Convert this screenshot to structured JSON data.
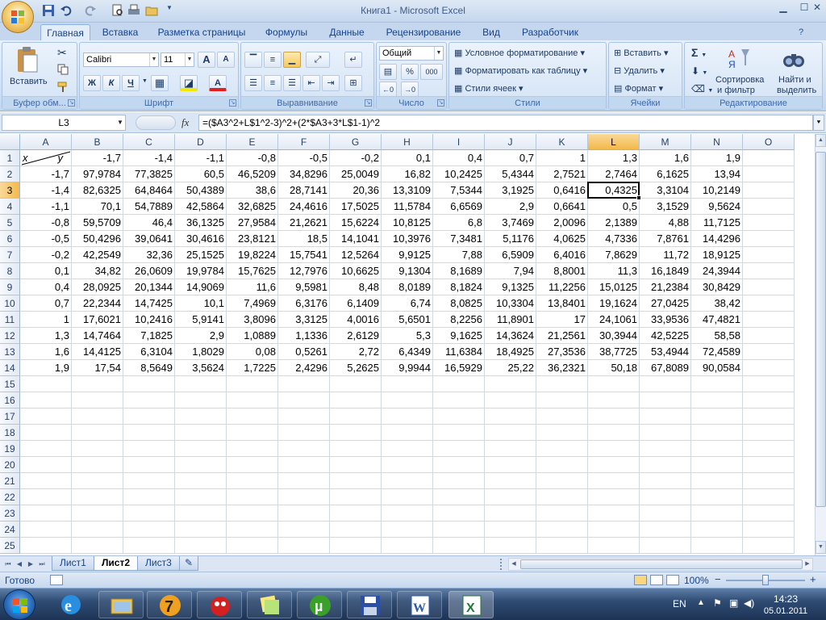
{
  "window": {
    "title": "Книга1 - Microsoft Excel"
  },
  "tabs": [
    "Главная",
    "Вставка",
    "Разметка страницы",
    "Формулы",
    "Данные",
    "Рецензирование",
    "Вид",
    "Разработчик"
  ],
  "ribbon": {
    "clipboard": {
      "label": "Буфер обм...",
      "paste": "Вставить"
    },
    "font": {
      "label": "Шрифт",
      "font_name": "Calibri",
      "font_size": "11",
      "bold": "Ж",
      "italic": "К",
      "underline": "Ч",
      "grow": "A",
      "shrink": "A",
      "font_color_glyph": "A"
    },
    "alignment": {
      "label": "Выравнивание"
    },
    "number": {
      "label": "Число",
      "format": "Общий",
      "percent": "%",
      "thousands": "000"
    },
    "styles": {
      "label": "Стили",
      "conditional": "Условное форматирование",
      "as_table": "Форматировать как таблицу",
      "cell_styles": "Стили ячеек"
    },
    "cells": {
      "label": "Ячейки",
      "insert": "Вставить",
      "delete": "Удалить",
      "format": "Формат"
    },
    "editing": {
      "label": "Редактирование",
      "sigma": "Σ",
      "sort": "Сортировка",
      "sort2": "и фильтр",
      "find": "Найти и",
      "find2": "выделить"
    }
  },
  "formula_bar": {
    "name_box": "L3",
    "fx": "fx",
    "formula": "=($A3^2+L$1^2-3)^2+(2*$A3+3*L$1-1)^2"
  },
  "grid": {
    "columns": [
      "A",
      "B",
      "C",
      "D",
      "E",
      "F",
      "G",
      "H",
      "I",
      "J",
      "K",
      "L",
      "M",
      "N",
      "O"
    ],
    "selected_column": "L",
    "selected_row": 3,
    "active_cell": "L3",
    "row_count": 25,
    "a1_x": "x",
    "a1_y": "y",
    "header_row": [
      "-1,7",
      "-1,4",
      "-1,1",
      "-0,8",
      "-0,5",
      "-0,2",
      "0,1",
      "0,4",
      "0,7",
      "1",
      "1,3",
      "1,6",
      "1,9"
    ],
    "rows": [
      [
        "-1,7",
        "97,9784",
        "77,3825",
        "60,5",
        "46,5209",
        "34,8296",
        "25,0049",
        "16,82",
        "10,2425",
        "5,4344",
        "2,7521",
        "2,7464",
        "6,1625",
        "13,94"
      ],
      [
        "-1,4",
        "82,6325",
        "64,8464",
        "50,4389",
        "38,6",
        "28,7141",
        "20,36",
        "13,3109",
        "7,5344",
        "3,1925",
        "0,6416",
        "0,4325",
        "3,3104",
        "10,2149"
      ],
      [
        "-1,1",
        "70,1",
        "54,7889",
        "42,5864",
        "32,6825",
        "24,4616",
        "17,5025",
        "11,5784",
        "6,6569",
        "2,9",
        "0,6641",
        "0,5",
        "3,1529",
        "9,5624"
      ],
      [
        "-0,8",
        "59,5709",
        "46,4",
        "36,1325",
        "27,9584",
        "21,2621",
        "15,6224",
        "10,8125",
        "6,8",
        "3,7469",
        "2,0096",
        "2,1389",
        "4,88",
        "11,7125"
      ],
      [
        "-0,5",
        "50,4296",
        "39,0641",
        "30,4616",
        "23,8121",
        "18,5",
        "14,1041",
        "10,3976",
        "7,3481",
        "5,1176",
        "4,0625",
        "4,7336",
        "7,8761",
        "14,4296"
      ],
      [
        "-0,2",
        "42,2549",
        "32,36",
        "25,1525",
        "19,8224",
        "15,7541",
        "12,5264",
        "9,9125",
        "7,88",
        "6,5909",
        "6,4016",
        "7,8629",
        "11,72",
        "18,9125"
      ],
      [
        "0,1",
        "34,82",
        "26,0609",
        "19,9784",
        "15,7625",
        "12,7976",
        "10,6625",
        "9,1304",
        "8,1689",
        "7,94",
        "8,8001",
        "11,3",
        "16,1849",
        "24,3944"
      ],
      [
        "0,4",
        "28,0925",
        "20,1344",
        "14,9069",
        "11,6",
        "9,5981",
        "8,48",
        "8,0189",
        "8,1824",
        "9,1325",
        "11,2256",
        "15,0125",
        "21,2384",
        "30,8429"
      ],
      [
        "0,7",
        "22,2344",
        "14,7425",
        "10,1",
        "7,4969",
        "6,3176",
        "6,1409",
        "6,74",
        "8,0825",
        "10,3304",
        "13,8401",
        "19,1624",
        "27,0425",
        "38,42"
      ],
      [
        "1",
        "17,6021",
        "10,2416",
        "5,9141",
        "3,8096",
        "3,3125",
        "4,0016",
        "5,6501",
        "8,2256",
        "11,8901",
        "17",
        "24,1061",
        "33,9536",
        "47,4821"
      ],
      [
        "1,3",
        "14,7464",
        "7,1825",
        "2,9",
        "1,0889",
        "1,1336",
        "2,6129",
        "5,3",
        "9,1625",
        "14,3624",
        "21,2561",
        "30,3944",
        "42,5225",
        "58,58"
      ],
      [
        "1,6",
        "14,4125",
        "6,3104",
        "1,8029",
        "0,08",
        "0,5261",
        "2,72",
        "6,4349",
        "11,6384",
        "18,4925",
        "27,3536",
        "38,7725",
        "53,4944",
        "72,4589"
      ],
      [
        "1,9",
        "17,54",
        "8,5649",
        "3,5624",
        "1,7225",
        "2,4296",
        "5,2625",
        "9,9944",
        "16,5929",
        "25,22",
        "36,2321",
        "50,18",
        "67,8089",
        "90,0584"
      ]
    ]
  },
  "sheets": [
    "Лист1",
    "Лист2",
    "Лист3"
  ],
  "active_sheet": "Лист2",
  "status": {
    "text": "Готово",
    "zoom": "100%",
    "minus": "−",
    "plus": "+"
  },
  "taskbar": {
    "lang": "EN",
    "time": "14:23",
    "date": "05.01.2011"
  },
  "colors": {
    "active_header": "#f3b949",
    "ribbon": "#cfdff3",
    "taskbar": "#1d3456"
  }
}
